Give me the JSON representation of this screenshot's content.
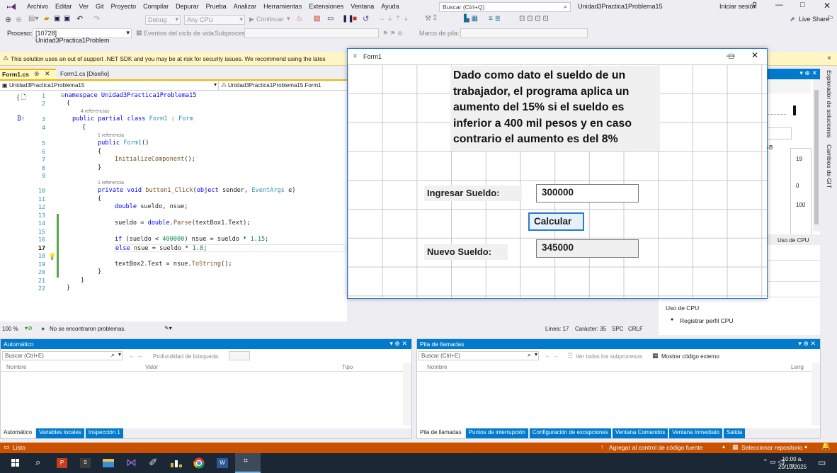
{
  "menu": {
    "items": [
      "Archivo",
      "Editar",
      "Ver",
      "Git",
      "Proyecto",
      "Compilar",
      "Depurar",
      "Prueba",
      "Analizar",
      "Herramientas",
      "Extensiones",
      "Ventana",
      "Ayuda"
    ],
    "search_placeholder": "Buscar (Ctrl+Q)",
    "solution_name": "Unidad3Practica1Problema15",
    "signin": "Iniciar sesión"
  },
  "toolbar": {
    "config": "Debug",
    "platform": "Any CPU",
    "continue": "Continuar",
    "liveshare": "Live Share"
  },
  "toolbar2": {
    "process_label": "Proceso:",
    "process_value": "[10728] Unidad3Practica1Problem",
    "lifecycle": "Eventos del ciclo de vida",
    "thread": "Subproceso:",
    "stack_frame": "Marco de pila:"
  },
  "warning": {
    "text": "This solution uses an out of support .NET SDK and you may be at risk for security issues. We recommend using the lates"
  },
  "editor": {
    "tab_active": "Form1.cs",
    "tab2": "Form1.cs [Diseño]",
    "nav_project": "Unidad3Practica1Problema15",
    "nav_class": "Unidad3Practica1Problema15.Form1",
    "zoom": "100 %",
    "problems": "No se encontraron problemas.",
    "line": "Línea: 17",
    "col": "Carácter: 35",
    "spc": "SPC",
    "crlf": "CRLF",
    "refs": {
      "r1": "4 referencias",
      "r2": "1 referencia",
      "r3": "1 referencia"
    },
    "lines": [
      "1",
      "2",
      "3",
      "4",
      "5",
      "6",
      "7",
      "8",
      "9",
      "10",
      "11",
      "12",
      "13",
      "14",
      "15",
      "16",
      "17",
      "18",
      "19",
      "20",
      "21",
      "22"
    ],
    "code": {
      "l1": "namespace Unidad3Practica1Problema15",
      "l2": "{",
      "l3a": "public partial class ",
      "l3b": "Form1",
      " l3c": ": ",
      "l3d": "Form",
      "l4": "{",
      "l5a": "public ",
      "l5b": "Form1",
      "l5c": "()",
      "l6": "{",
      "l7": "InitializeComponent();",
      "l8": "}",
      "l10a": "private void ",
      "l10b": "button1_Click",
      "l10c": "(",
      "l10d": "object",
      " l10e": " sender, ",
      "l10f": "EventArgs",
      " l10g": " e)",
      "l11": "{",
      "l12a": "double",
      " l12b": " sueldo, nsue;",
      "l14a": "sueldo = ",
      "l14b": "double",
      ".l14c": ".",
      "l14d": "Parse",
      "l14e": "(textBox1.Text);",
      "l16a": "if",
      " l16b": " (sueldo < ",
      "l16c": "400000",
      ") l16d": ") nsue = sueldo * ",
      "l16e": "1.15",
      ";l16f": ";",
      "l17a": "else",
      " l17b": " nsue = sueldo * ",
      "l17c": "1.8",
      ";l17d": ";",
      "l19a": "textBox2.Text = nsue.",
      "l19b": "ToString",
      "l19c": "();",
      "l20": "}",
      "l21": "}",
      "l22": "}"
    }
  },
  "form": {
    "title": "Form1",
    "description": "Dado como dato el sueldo de un trabajador, el programa aplica un aumento del 15% si el sueldo es inferior a 400 mil pesos y en caso contrario el aumento es del 8%",
    "label1": "Ingresar Sueldo:",
    "input1": "300000",
    "button": "Calcular",
    "label2": "Nuevo Sueldo:",
    "input2": "345000"
  },
  "diag": {
    "n19": "19",
    "n0": "0",
    "n100": "100",
    "use_cpu_tab": "Uso de CPU",
    "cpu_title": "Uso de CPU",
    "record": "Registrar perfil CPU",
    "side1": "Explorador de soluciones",
    "side2": "Cambios de GIT",
    "frag_a": "a",
    "frag_b": "B",
    "frag_s": ")"
  },
  "autos": {
    "title": "Automático",
    "search": "Buscar (Ctrl+E)",
    "depth": "Profundidad de búsqueda:",
    "col_name": "Nombre",
    "col_value": "Valor",
    "col_type": "Tipo",
    "tabs": [
      "Automático",
      "Variables locales",
      "Inspección 1"
    ]
  },
  "callstack": {
    "title": "Pila de llamadas",
    "search": "Buscar (Ctrl+E)",
    "all_threads": "Ver todos los subprocesos",
    "show_external": "Mostrar código externo",
    "col_name": "Nombre",
    "col_lang": "Leng",
    "tabs": [
      "Pila de llamadas",
      "Puntos de interrupción",
      "Configuración de excepciones",
      "Ventana Comandos",
      "Ventana Inmediato",
      "Salida"
    ]
  },
  "status": {
    "ready": "Listo",
    "source_control": "Agregar al control de código fuente",
    "repo": "Seleccionar repositorio"
  },
  "taskbar": {
    "time": "10:00 a. m.",
    "date": "20/10/2025"
  },
  "colors": {
    "accent": "#007acc",
    "status_bar": "#ca5100",
    "taskbar": "#1b2735",
    "blue_tab": "#007acc"
  }
}
